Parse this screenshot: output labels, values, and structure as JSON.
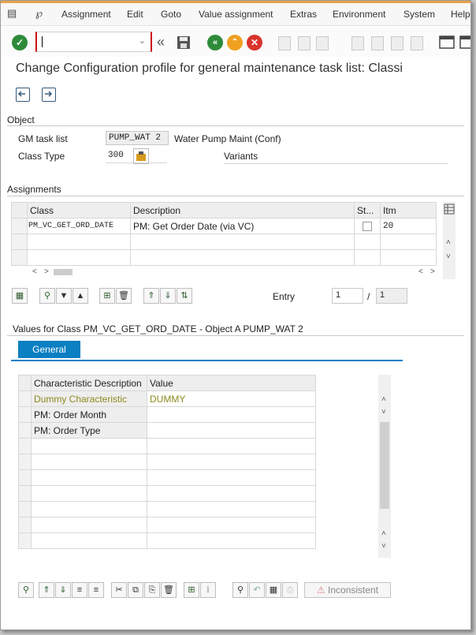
{
  "menu": {
    "items": [
      "Assignment",
      "Edit",
      "Goto",
      "Value assignment",
      "Extras",
      "Environment",
      "System",
      "Help"
    ]
  },
  "toolbar": {
    "command_field_value": ""
  },
  "page": {
    "title": "Change Configuration profile for general maintenance task list: Classi"
  },
  "object": {
    "group_title": "Object",
    "gm_task_list_label": "GM task list",
    "gm_task_list_value": "PUMP_WAT 2",
    "gm_task_list_desc": "Water Pump Maint (Conf)",
    "class_type_label": "Class Type",
    "class_type_value": "300",
    "variants_label": "Variants"
  },
  "assignments": {
    "group_title": "Assignments",
    "columns": [
      "Class",
      "Description",
      "St...",
      "Itm"
    ],
    "rows": [
      {
        "class": "PM_VC_GET_ORD_DATE",
        "description": "PM: Get Order Date (via VC)",
        "status": "",
        "item": "20"
      }
    ],
    "entry_label": "Entry",
    "entry_current": "1",
    "entry_separator": "/",
    "entry_total": "1"
  },
  "values": {
    "title": "Values for Class PM_VC_GET_ORD_DATE - Object A PUMP_WAT 2",
    "tab_label": "General",
    "columns": [
      "Characteristic Description",
      "Value"
    ],
    "rows": [
      {
        "characteristic": "Dummy Characteristic",
        "value": "DUMMY"
      },
      {
        "characteristic": "PM: Order Month",
        "value": ""
      },
      {
        "characteristic": "PM: Order Type",
        "value": ""
      }
    ],
    "inconsistent_label": "Inconsistent"
  },
  "colors": {
    "accent_blue": "#0a7fc2",
    "ok_green": "#2e8b3a",
    "cancel_red": "#d8342c",
    "exit_orange": "#f0a020",
    "dummy_text": "#8a8a1e"
  }
}
